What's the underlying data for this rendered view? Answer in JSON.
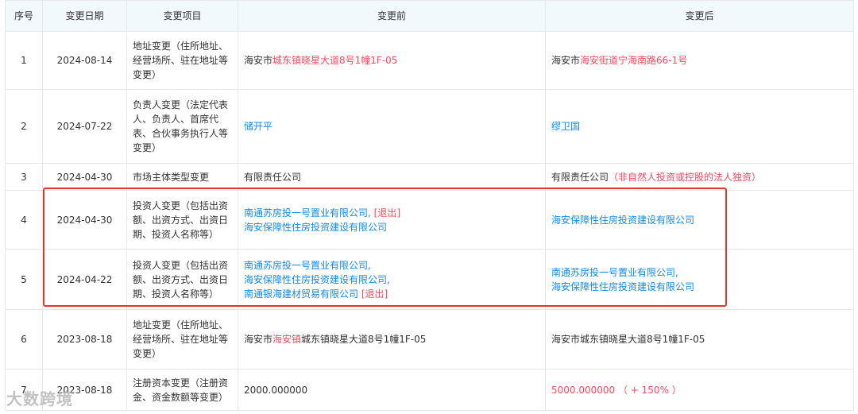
{
  "headers": [
    "序号",
    "变更日期",
    "变更项目",
    "变更前",
    "变更后"
  ],
  "rows": [
    {
      "idx": "1",
      "date": "2024-08-14",
      "item": "地址变更（住所地址、经营场所、驻在地址等变更）",
      "before": [
        [
          {
            "t": "海安市",
            "c": ""
          },
          {
            "t": "城东镇晓星大道8号1幢1F-05",
            "c": "red"
          }
        ]
      ],
      "after": [
        [
          {
            "t": "海安市",
            "c": ""
          },
          {
            "t": "海安街道宁海南路66-1号",
            "c": "red"
          }
        ]
      ]
    },
    {
      "idx": "2",
      "date": "2024-07-22",
      "item": "负责人变更（法定代表人、负责人、首席代表、合伙事务执行人等变更）",
      "before": [
        [
          {
            "t": "储开平",
            "c": "blue"
          }
        ]
      ],
      "after": [
        [
          {
            "t": "缪卫国",
            "c": "blue"
          }
        ]
      ]
    },
    {
      "idx": "3",
      "date": "2024-04-30",
      "item": "市场主体类型变更",
      "before": [
        [
          {
            "t": "有限责任公司",
            "c": ""
          }
        ]
      ],
      "after": [
        [
          {
            "t": "有限责任公司",
            "c": ""
          },
          {
            "t": "（非自然人投资或控股的法人独资）",
            "c": "red"
          }
        ]
      ]
    },
    {
      "idx": "4",
      "date": "2024-04-30",
      "item": "投资人变更（包括出资额、出资方式、出资日期、投资人名称等）",
      "before": [
        [
          {
            "t": "南通苏房投一号置业有限公司,",
            "c": "blue"
          },
          {
            "t": " [退出]",
            "c": "red"
          }
        ],
        [
          {
            "t": "海安保障性住房投资建设有限公司",
            "c": "blue"
          }
        ]
      ],
      "after": [
        [
          {
            "t": "海安保障性住房投资建设有限公司",
            "c": "blue"
          }
        ]
      ]
    },
    {
      "idx": "5",
      "date": "2024-04-22",
      "item": "投资人变更（包括出资额、出资方式、出资日期、投资人名称等）",
      "before": [
        [
          {
            "t": "南通苏房投一号置业有限公司,",
            "c": "blue"
          }
        ],
        [
          {
            "t": "海安保障性住房投资建设有限公司,",
            "c": "blue"
          }
        ],
        [
          {
            "t": "南通银海建材贸易有限公司",
            "c": "blue"
          },
          {
            "t": " [退出]",
            "c": "red"
          }
        ]
      ],
      "after": [
        [
          {
            "t": "南通苏房投一号置业有限公司,",
            "c": "blue"
          }
        ],
        [
          {
            "t": "海安保障性住房投资建设有限公司",
            "c": "blue"
          }
        ]
      ]
    },
    {
      "idx": "6",
      "date": "2023-08-18",
      "item": "地址变更（住所地址、经营场所、驻在地址等变更）",
      "before": [
        [
          {
            "t": "海安市",
            "c": ""
          },
          {
            "t": "海安镇",
            "c": "red"
          },
          {
            "t": "城东镇晓星大道8号1幢1F-05",
            "c": ""
          }
        ]
      ],
      "after": [
        [
          {
            "t": "海安市城东镇晓星大道8号1幢1F-05",
            "c": ""
          }
        ]
      ]
    },
    {
      "idx": "7",
      "date": "2023-08-18",
      "item": "注册资本变更（注册资金、资金数额等变更）",
      "before": [
        [
          {
            "t": "2000.000000",
            "c": ""
          }
        ]
      ],
      "after": [
        [
          {
            "t": "5000.000000 （ + 150% ）",
            "c": "red"
          }
        ]
      ]
    }
  ],
  "watermark": "大数跨境",
  "colors": {
    "header_bg": "#f2f9fc",
    "link": "#128bed",
    "change": "#fd485e",
    "highlight_border": "#e5352b"
  }
}
